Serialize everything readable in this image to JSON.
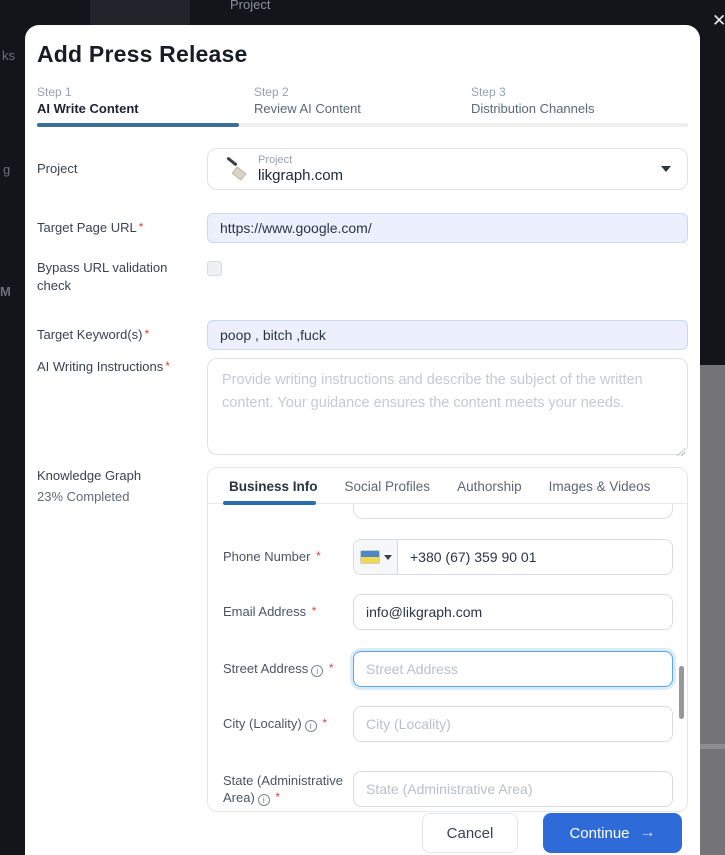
{
  "colors": {
    "accent_blue": "#2f6bd8",
    "progress_blue": "#3d6e96",
    "tab_underline_blue": "#2b6cb0",
    "filled_input_bg": "#ebf0fc",
    "focus_border_blue": "#58a6e8",
    "required_red": "#d64545",
    "backdrop_dark": "#14151a"
  },
  "ui": {
    "required_mark": "*"
  },
  "backdrop": {
    "top_label": "Project",
    "fragments": [
      "ks",
      "g",
      "M"
    ],
    "close_icon": "✕"
  },
  "modal": {
    "title": "Add Press Release",
    "progress_percent": 31,
    "steps": [
      {
        "step": "Step 1",
        "label": "AI Write Content"
      },
      {
        "step": "Step 2",
        "label": "Review AI Content"
      },
      {
        "step": "Step 3",
        "label": "Distribution Channels"
      }
    ],
    "form": {
      "project": {
        "label": "Project",
        "field_caption": "Project",
        "value": "likgraph.com",
        "icon": "brush-favicon"
      },
      "target_page_url": {
        "label": "Target Page URL",
        "value": "https://www.google.com/"
      },
      "bypass": {
        "label": "Bypass URL validation check",
        "checked": false
      },
      "target_keywords": {
        "label": "Target Keyword(s)",
        "value": "poop , bitch ,fuck"
      },
      "ai_instructions": {
        "label": "AI Writing Instructions",
        "placeholder": "Provide writing instructions and describe the subject of the written content. Your guidance ensures the content meets your needs."
      },
      "knowledge_graph": {
        "label": "Knowledge Graph",
        "completed": "23% Completed",
        "tabs": [
          {
            "label": "Business Info"
          },
          {
            "label": "Social Profiles"
          },
          {
            "label": "Authorship"
          },
          {
            "label": "Images & Videos"
          }
        ],
        "active_tab": "Business Info",
        "fields": [
          {
            "label": "Phone Number",
            "type": "phone",
            "country": "Ukraine",
            "value": "+380 (67) 359 90 01"
          },
          {
            "label": "Email Address",
            "value": "info@likgraph.com"
          },
          {
            "label": "Street Address",
            "placeholder": "Street Address",
            "focused": true
          },
          {
            "label": "City (Locality)",
            "placeholder": "City (Locality)"
          },
          {
            "label": "State (Administrative Area)",
            "placeholder": "State (Administrative Area)"
          }
        ]
      }
    },
    "footer": {
      "cancel": "Cancel",
      "continue": "Continue",
      "continue_arrow": "→"
    }
  }
}
